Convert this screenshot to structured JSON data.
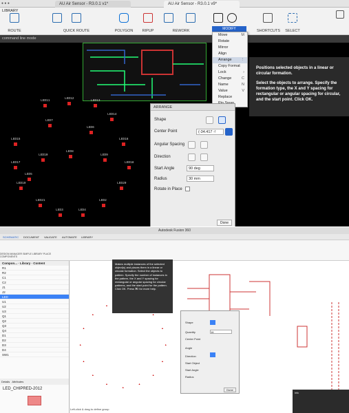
{
  "window": {
    "tab1": "AU Air Sensor - R3.0.1 v1*",
    "tab2": "AU Air Sensor - R3.0.1 v9*"
  },
  "panel_left": "LIBRARY",
  "ribbon": {
    "groups": [
      "ROUTE",
      "QUICK ROUTE",
      "POLYGON",
      "RIPUP",
      "REWORK",
      "MODIFY",
      "SHORTCUTS",
      "SELECT"
    ]
  },
  "command_line": "command line mode",
  "modify_menu": {
    "header": "MODIFY",
    "items": [
      {
        "label": "Move",
        "shortcut": "M"
      },
      {
        "label": "Rotate",
        "shortcut": ""
      },
      {
        "label": "Mirror",
        "shortcut": ""
      },
      {
        "label": "Align",
        "shortcut": ""
      },
      {
        "label": "Arrange",
        "shortcut": ""
      },
      {
        "label": "Copy Format",
        "shortcut": ""
      },
      {
        "label": "Lock",
        "shortcut": ""
      },
      {
        "label": "Change",
        "shortcut": "C"
      },
      {
        "label": "Name",
        "shortcut": "N"
      },
      {
        "label": "Value",
        "shortcut": "V"
      },
      {
        "label": "Replace",
        "shortcut": ""
      },
      {
        "label": "Pin Swap",
        "shortcut": ""
      }
    ]
  },
  "tooltip": {
    "p1": "Positions selected objects in a linear or circular formation.",
    "p2": "Select the objects to arrange. Specify the formation type, the X and Y spacing for rectangular or angular spacing for circular, and the start point. Click OK."
  },
  "arrange": {
    "title": "ARRANGE",
    "shape": "Shape",
    "center": "Center Point",
    "center_val": "(-34.417 -!",
    "angular": "Angular Spacing",
    "direction": "Direction",
    "start_angle": "Start Angle",
    "start_val": "90 deg",
    "radius": "Radius",
    "radius_val": "30 mm",
    "rotate": "Rotate in Place",
    "done": "Done"
  },
  "leds": [
    "LED11",
    "LED12",
    "LED13",
    "LED14",
    "LED15",
    "LED16",
    "LED17",
    "LED18",
    "LED19",
    "LED20",
    "LED21",
    "LED2",
    "LED3",
    "LED4",
    "LED5",
    "LED6",
    "LED7",
    "LED8",
    "LED9",
    "LED10"
  ],
  "bottom": {
    "title": "Autodesk Fusion 360",
    "tabs": [
      "SCHEMATIC",
      "DOCUMENT",
      "VALIDATE",
      "AUTOMATE",
      "LIBRARY"
    ],
    "left_tabs": [
      "DESIGN MANAGER",
      "SIMPLE LIBRARY",
      "PLACE COMPONENTS"
    ],
    "tree_header": [
      "Compon...",
      "Library",
      "Content"
    ],
    "rows": [
      "R1",
      "R2",
      "C1",
      "C2",
      "J1",
      "J2",
      "LED",
      "U1",
      "U2",
      "U3",
      "Q1",
      "Q2",
      "Q3",
      "Q4",
      "D1",
      "D2",
      "D3",
      "D4",
      "SW1"
    ],
    "details_tabs": [
      "Details",
      "Attributes"
    ],
    "part": "LED_CHIPRED-2012",
    "tip": "Makes multiple instances of the selected object(s) and places them in a linear or circular formation. Select the objects to pattern. Specify the number of instances in the pattern, the X and Y spacing for rectangular or angular spacing for circular patterns, and the start point for the pattern. Click OK. Press ⌘/ for more help.",
    "dlg": {
      "shape": "Shape",
      "quantity": "Quantity",
      "qty_val": "16",
      "center": "Center Point",
      "angle": "Angle",
      "direction": "Direction",
      "start_obj": "Start Object",
      "start_angle": "Start Angle",
      "radius": "Radius",
      "done": "Done"
    },
    "status": "Left-click & drag to define group",
    "info": "Info"
  },
  "colors": {
    "accent": "#2563c9",
    "pad": "#dd2222",
    "pcb_bg": "#000000"
  }
}
